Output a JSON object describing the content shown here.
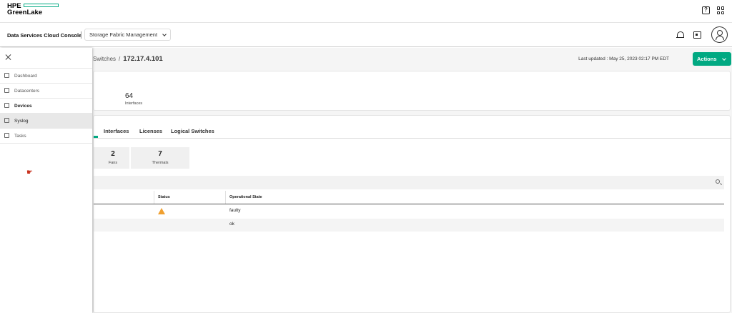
{
  "header": {
    "logo_line1": "HPE",
    "logo_line2": "GreenLake",
    "help_icon": "help-icon",
    "apps_icon": "app-grid-icon"
  },
  "subheader": {
    "app_title": "Data Services Cloud Console",
    "service_selector": "Storage Fabric Management"
  },
  "breadcrumb": {
    "parent": "Switches",
    "separator": "/",
    "current": "172.17.4.101"
  },
  "last_updated": "Last updated :  May 25, 2023 02:17 PM EDT",
  "actions_label": "Actions",
  "summary": {
    "interfaces_value": "64",
    "interfaces_label": "Interfaces"
  },
  "tabs": [
    "Interfaces",
    "Licenses",
    "Logical Switches"
  ],
  "tiles": [
    {
      "value": "2",
      "label": "Fans"
    },
    {
      "value": "7",
      "label": "Thermals"
    }
  ],
  "table": {
    "columns": [
      "Status",
      "Operational State"
    ],
    "rows": [
      {
        "status": "warning",
        "state": "faulty"
      },
      {
        "status": "",
        "state": "ok"
      }
    ]
  },
  "nav": {
    "items": [
      {
        "label": "Dashboard"
      },
      {
        "label": "Datacenters"
      },
      {
        "label": "Devices"
      },
      {
        "label": "Syslog"
      },
      {
        "label": "Tasks"
      }
    ]
  },
  "colors": {
    "accent": "#01a982",
    "warning": "#f0a030"
  }
}
